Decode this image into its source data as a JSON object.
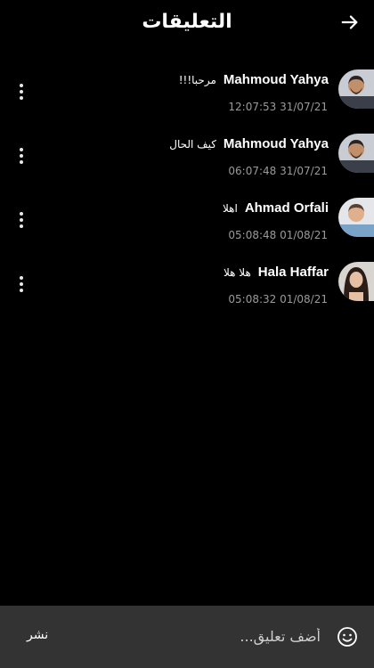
{
  "header": {
    "title": "التعليقات",
    "back_icon": "arrow-right-icon"
  },
  "comments": [
    {
      "author": "Mahmoud Yahya",
      "text": "مرحبا!!!",
      "time": "12:07:53 31/07/21",
      "avatar": "avatar-man-beard"
    },
    {
      "author": "Mahmoud Yahya",
      "text": "كيف الحال",
      "time": "06:07:48 31/07/21",
      "avatar": "avatar-man-beard"
    },
    {
      "author": "Ahmad Orfali",
      "text": "اهلا",
      "time": "05:08:48 01/08/21",
      "avatar": "avatar-man-light"
    },
    {
      "author": "Hala Haffar",
      "text": "هلا هلا",
      "time": "05:08:32 01/08/21",
      "avatar": "avatar-woman"
    }
  ],
  "composer": {
    "placeholder": "أضف تعليق...",
    "publish_label": "نشر",
    "emoji_icon": "smiley-icon"
  },
  "colors": {
    "background": "#000000",
    "composer_bg": "#333333",
    "timestamp": "#9a9a9a"
  }
}
